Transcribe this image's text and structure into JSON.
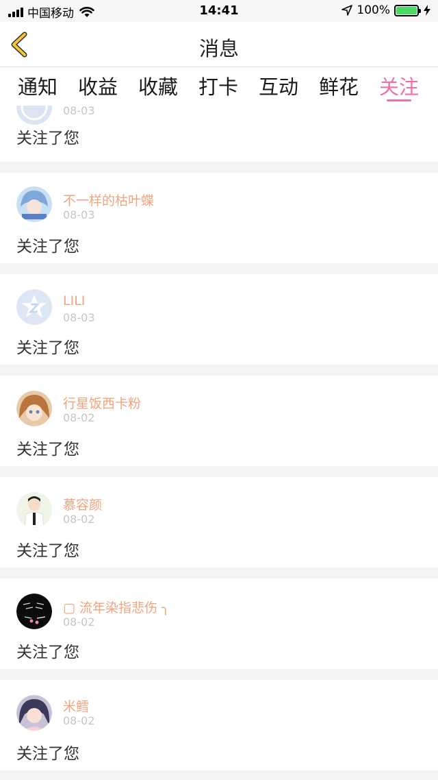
{
  "status_bar": {
    "carrier": "中国移动",
    "time": "14:41",
    "battery_pct": "100%"
  },
  "nav": {
    "title": "消息",
    "back_icon": "chevron-left-icon"
  },
  "colors": {
    "accent": "#ee70a6",
    "username": "#f0a47d",
    "back_icon": "#f3c73a",
    "battery": "#4cd964"
  },
  "tabs": [
    {
      "label": "通知"
    },
    {
      "label": "收益"
    },
    {
      "label": "收藏"
    },
    {
      "label": "打卡"
    },
    {
      "label": "互动"
    },
    {
      "label": "鲜花"
    },
    {
      "label": "关注",
      "active": true
    }
  ],
  "notifications": [
    {
      "name": "",
      "date": "08-03",
      "message": "关注了您"
    },
    {
      "name": "不一样的枯叶蝶",
      "date": "08-03",
      "message": "关注了您"
    },
    {
      "name": "LILI",
      "date": "08-03",
      "message": "关注了您"
    },
    {
      "name": "行星饭西卡粉",
      "date": "08-02",
      "message": "关注了您"
    },
    {
      "name": "慕容颜",
      "date": "08-02",
      "message": "关注了您"
    },
    {
      "name": "▢ 流年染指悲伤 ╮",
      "date": "08-02",
      "message": "关注了您"
    },
    {
      "name": "米鳕",
      "date": "08-02",
      "message": "关注了您"
    }
  ]
}
